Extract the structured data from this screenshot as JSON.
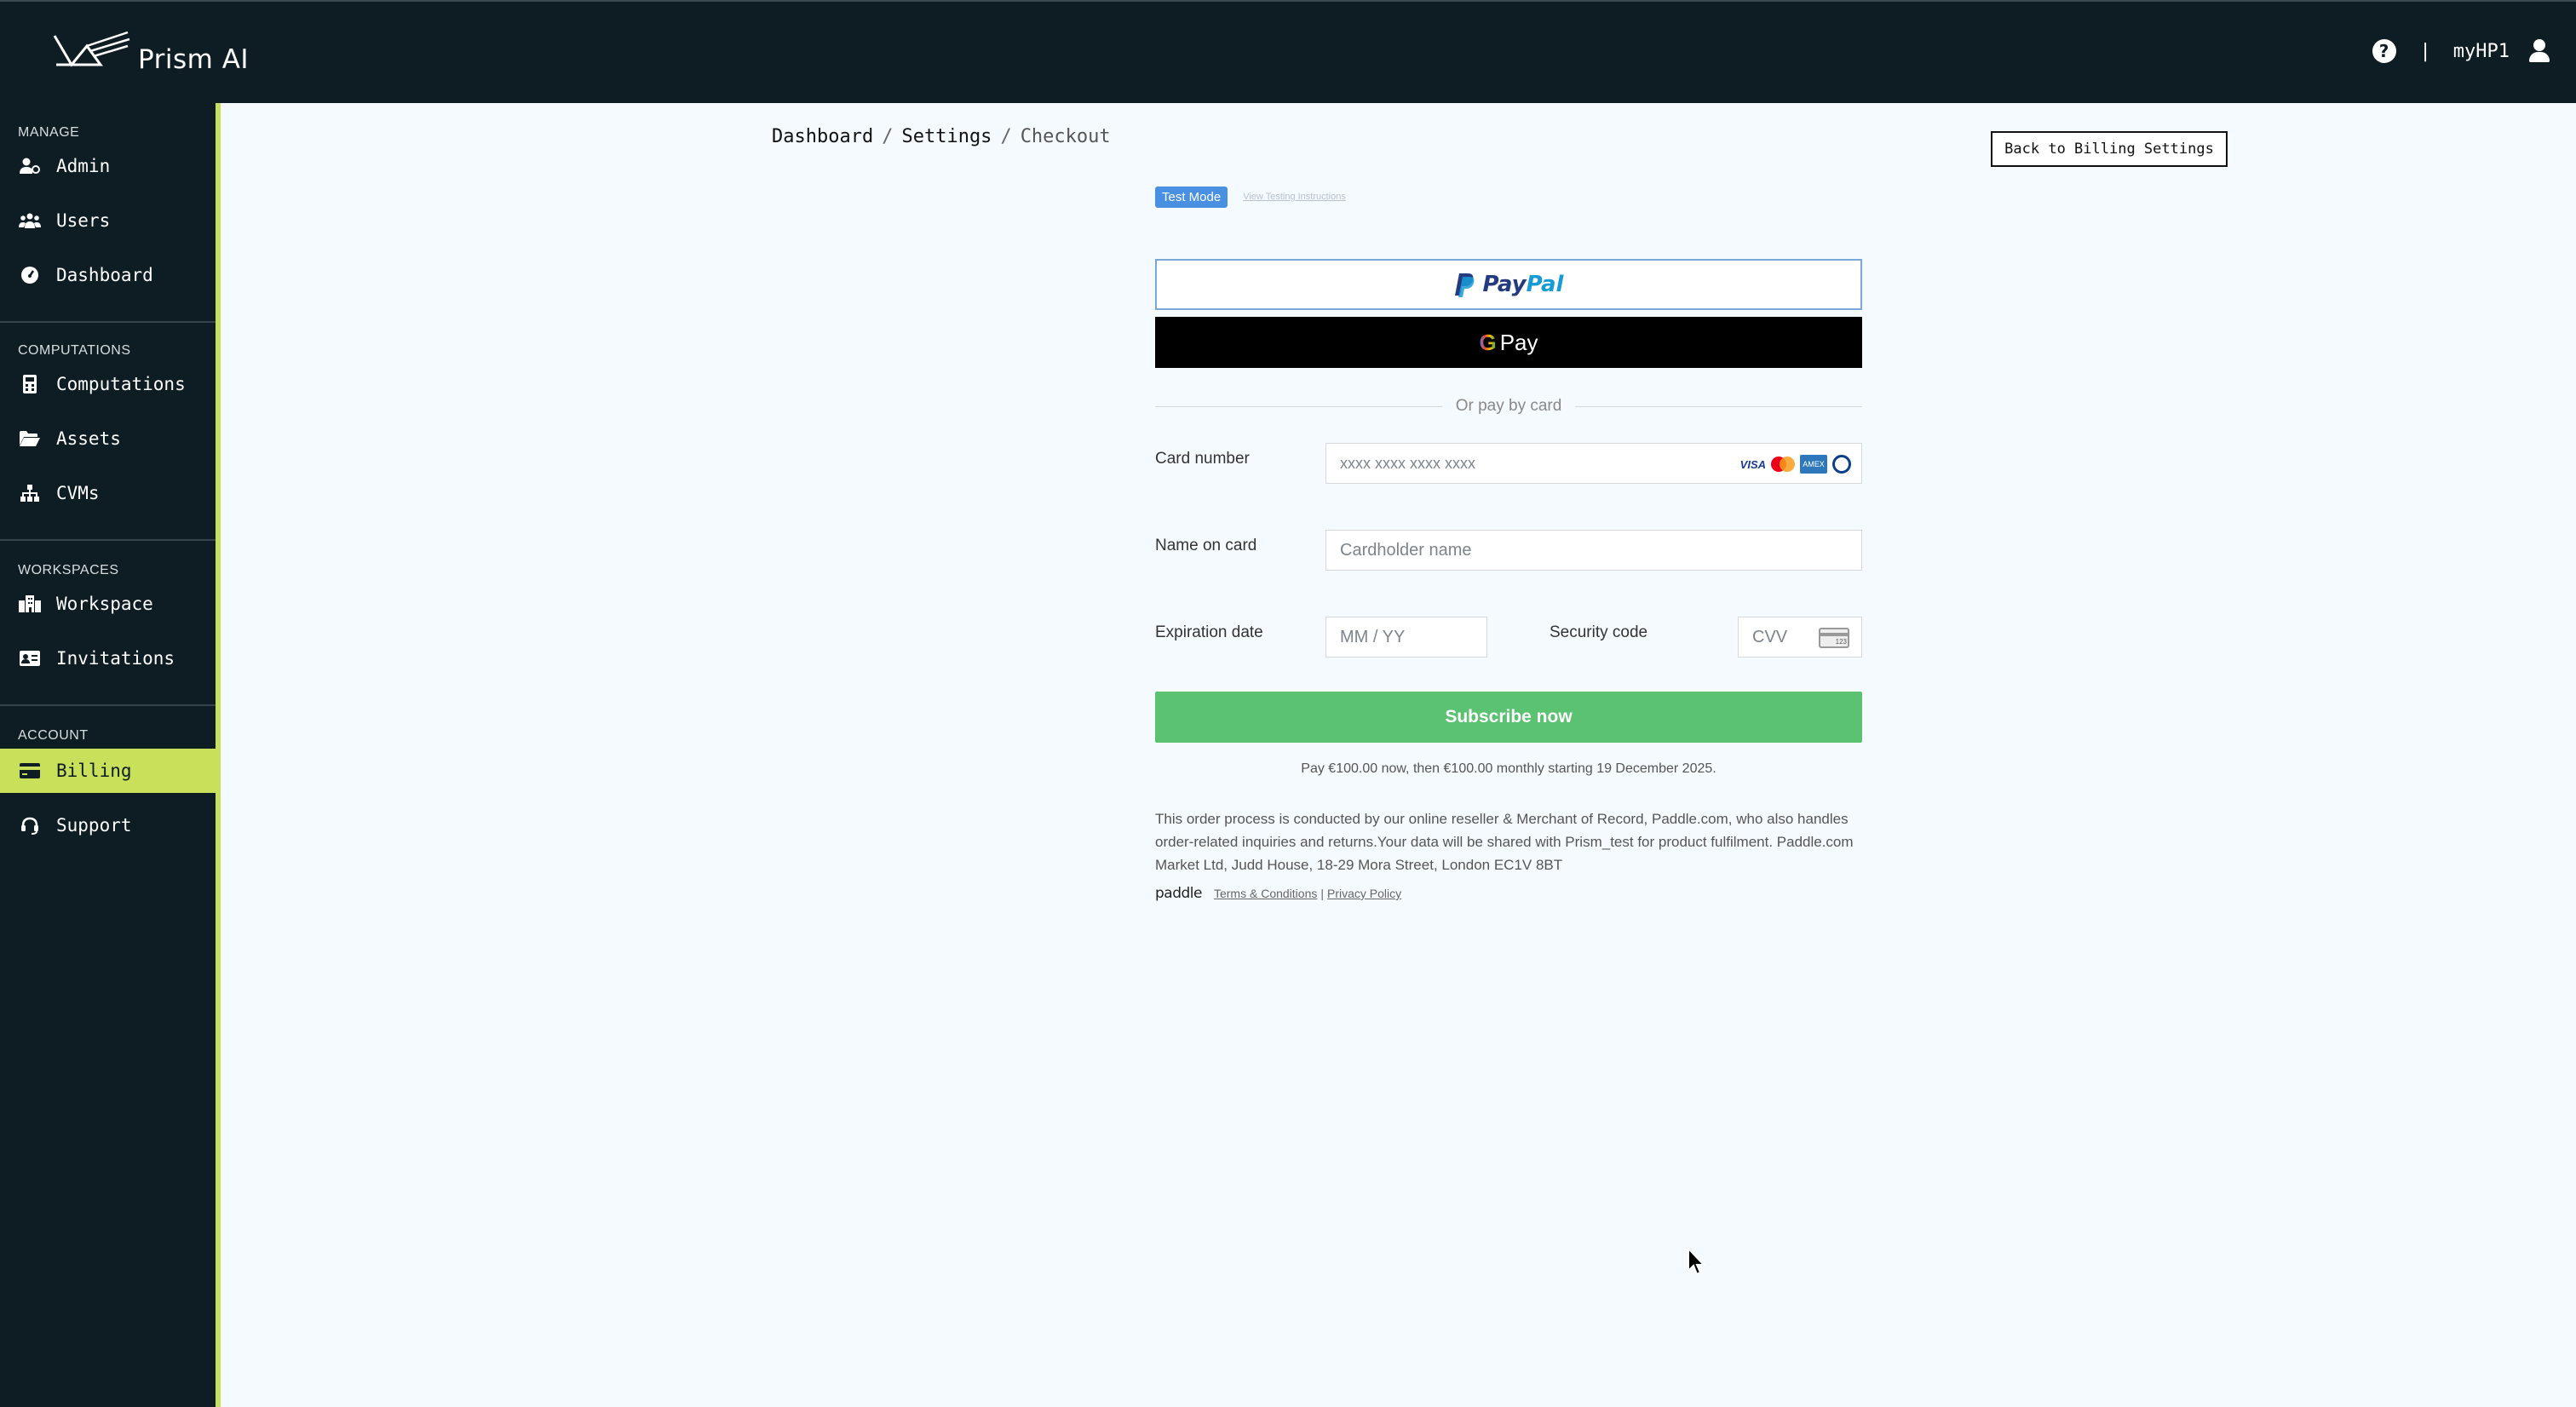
{
  "app": {
    "brand": "Prism AI"
  },
  "topbar": {
    "separator": "|",
    "username": "myHP1"
  },
  "sidebar": {
    "sections": [
      {
        "title": "MANAGE",
        "items": [
          {
            "label": "Admin"
          },
          {
            "label": "Users"
          },
          {
            "label": "Dashboard"
          }
        ]
      },
      {
        "title": "COMPUTATIONS",
        "items": [
          {
            "label": "Computations"
          },
          {
            "label": "Assets"
          },
          {
            "label": "CVMs"
          }
        ]
      },
      {
        "title": "WORKSPACES",
        "items": [
          {
            "label": "Workspace"
          },
          {
            "label": "Invitations"
          }
        ]
      },
      {
        "title": "ACCOUNT",
        "items": [
          {
            "label": "Billing",
            "active": true
          },
          {
            "label": "Support"
          }
        ]
      }
    ],
    "active_color": "#c9e05a"
  },
  "breadcrumb": {
    "items": [
      "Dashboard",
      "Settings",
      "Checkout"
    ],
    "separator": "/"
  },
  "back_button": {
    "label": "Back to Billing Settings"
  },
  "checkout": {
    "test_badge": "Test Mode",
    "test_link": "View Testing Instructions",
    "paypal_label_1": "Pay",
    "paypal_label_2": "Pal",
    "gpay_g": "G",
    "gpay_label": "Pay",
    "or_text": "Or pay by card",
    "card_number_label": "Card number",
    "card_number_placeholder": "xxxx xxxx xxxx xxxx",
    "card_brands": [
      "VISA",
      "Mastercard",
      "AMEX",
      "Diners"
    ],
    "visa_text": "VISA",
    "amex_text": "AMEX",
    "name_label": "Name on card",
    "name_placeholder": "Cardholder name",
    "expiry_label": "Expiration date",
    "expiry_placeholder": "MM / YY",
    "cvv_label": "Security code",
    "cvv_placeholder": "CVV",
    "cvv_badge": "123",
    "subscribe_label": "Subscribe now",
    "subscribe_color": "#5ac270",
    "pay_note": "Pay €100.00 now, then €100.00 monthly starting 19 December 2025.",
    "merchant_text": "This order process is conducted by our online reseller & Merchant of Record, Paddle.com, who also handles order-related inquiries and returns.Your data will be shared with Prism_test for product fulfilment. Paddle.com Market Ltd, Judd House, 18-29 Mora Street, London EC1V 8BT",
    "paddle_logo": "paddle",
    "terms_label": "Terms & Conditions",
    "legal_sep": "|",
    "privacy_label": "Privacy Policy"
  }
}
